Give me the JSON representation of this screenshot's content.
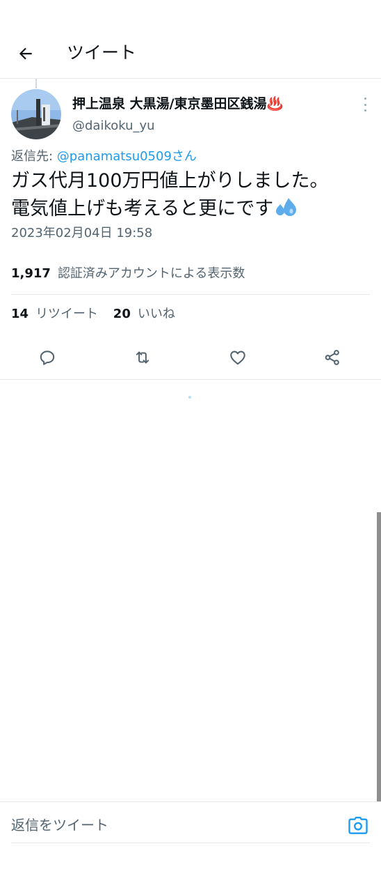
{
  "header": {
    "title": "ツイート"
  },
  "tweet": {
    "display_name": "押上温泉 大黒湯/東京墨田区銭湯♨️",
    "handle": "@daikoku_yu",
    "reply_prefix": "返信先: ",
    "reply_to": "@panamatsu0509さん",
    "text_line1": "ガス代月100万円値上がりしました。",
    "text_line2": "電気値上げも考えると更にです",
    "text_emoji": "sweat-droplets",
    "timestamp": "2023年02月04日 19:58",
    "views_count": "1,917",
    "views_label": "認証済みアカウントによる表示数",
    "retweets_count": "14",
    "retweets_label": "リツイート",
    "likes_count": "20",
    "likes_label": "いいね"
  },
  "actions": [
    "reply-icon",
    "retweet-icon",
    "like-icon",
    "share-icon"
  ],
  "reply_bar": {
    "placeholder": "返信をツイート",
    "icon": "camera-icon"
  },
  "colors": {
    "accent": "#1d9bf0",
    "text": "#0f1419",
    "muted": "#536471",
    "border": "#e6e9ec"
  }
}
